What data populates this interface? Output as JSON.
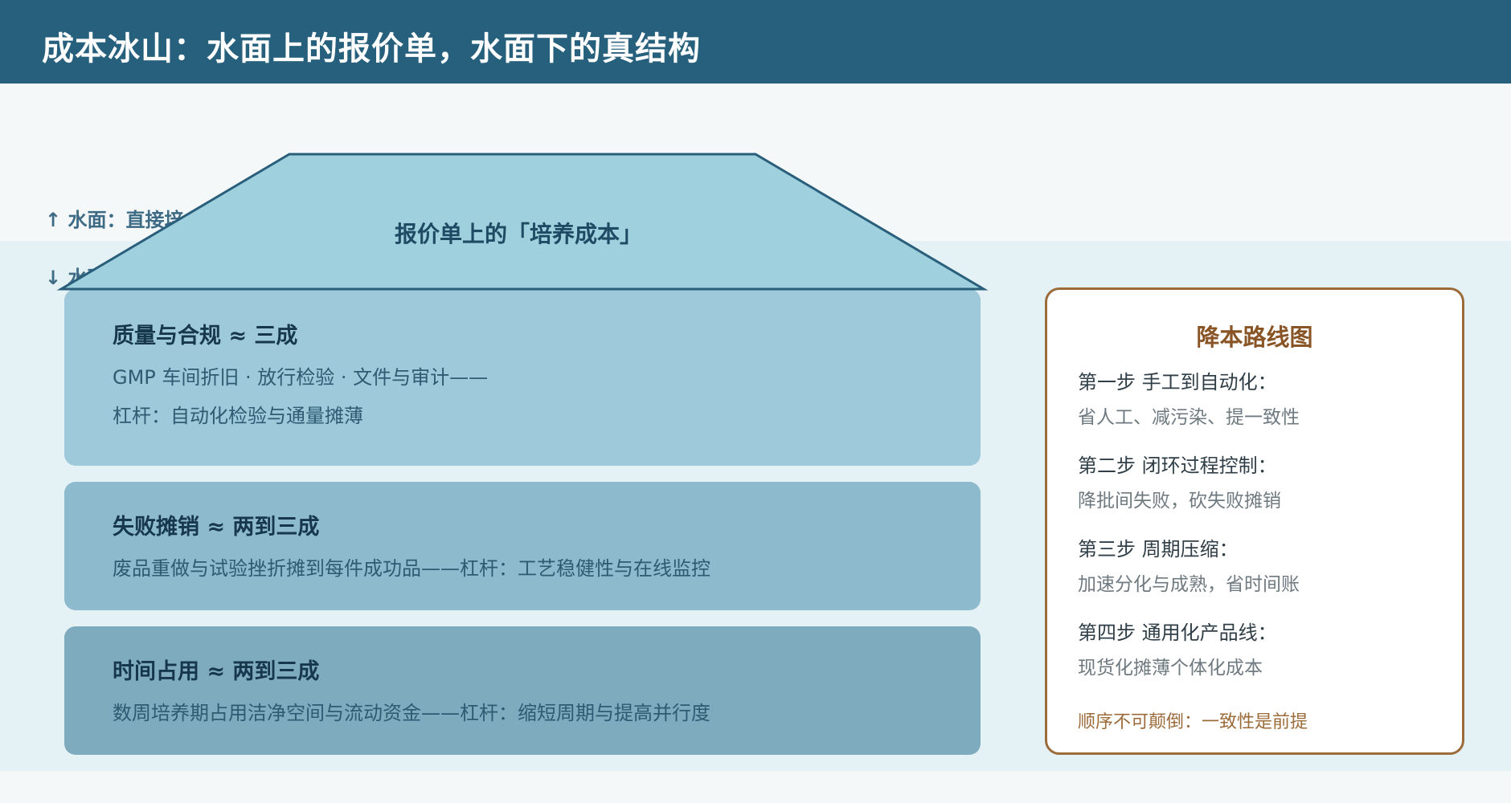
{
  "header": {
    "title": "成本冰山：水面上的报价单，水面下的真结构"
  },
  "water_labels": {
    "above": "↑ 水面：直接培",
    "below": "↓ 水面"
  },
  "tip": {
    "label": "报价单上的「培养成本」"
  },
  "blocks": [
    {
      "title": "质量与合规 ≈ 三成",
      "lines": [
        "GMP 车间折旧 · 放行检验 · 文件与审计——",
        "杠杆：自动化检验与通量摊薄"
      ]
    },
    {
      "title": "失败摊销 ≈ 两到三成",
      "lines": [
        "废品重做与试验挫折摊到每件成功品——杠杆：工艺稳健性与在线监控"
      ]
    },
    {
      "title": "时间占用 ≈ 两到三成",
      "lines": [
        "数周培养期占用洁净空间与流动资金——杠杆：缩短周期与提高并行度"
      ]
    }
  ],
  "roadmap": {
    "title": "降本路线图",
    "steps": [
      {
        "head": "第一步 手工到自动化：",
        "desc": "省人工、减污染、提一致性"
      },
      {
        "head": "第二步 闭环过程控制：",
        "desc": "降批间失败，砍失败摊销"
      },
      {
        "head": "第三步 周期压缩：",
        "desc": "加速分化与成熟，省时间账"
      },
      {
        "head": "第四步 通用化产品线：",
        "desc": "现货化摊薄个体化成本"
      }
    ],
    "note": "顺序不可颠倒：一致性是前提"
  },
  "colors": {
    "header": "#26607d",
    "tip_fill": "#9fd0de",
    "tip_stroke": "#2a5f7c",
    "block_1": "#9ec9da",
    "block_2": "#8dbacd",
    "block_3": "#7eabbe",
    "roadmap_border": "#9c6b3a"
  }
}
